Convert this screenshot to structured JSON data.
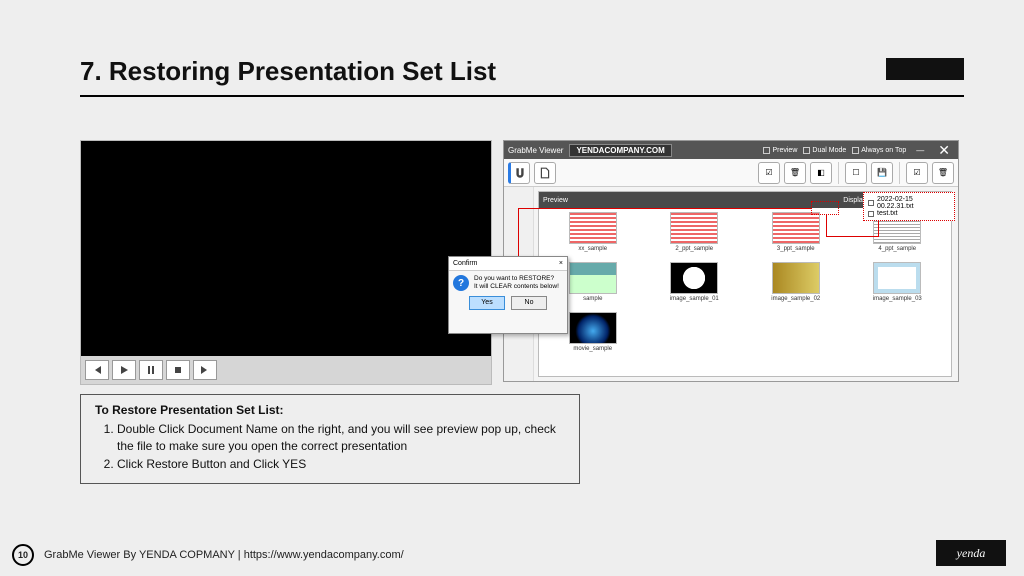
{
  "title": "7. Restoring Presentation Set List",
  "page_number": "10",
  "footer_text": "GrabMe Viewer By YENDA COPMANY | https://www.yendacompany.com/",
  "brand": "yenda",
  "instructions": {
    "heading": "To Restore Presentation Set List:",
    "steps": [
      "Double Click Document Name on the right, and you will see preview pop up, check the file to make sure you open the correct presentation",
      "Click Restore Button and Click YES"
    ]
  },
  "gm": {
    "title": "GrabMe Viewer",
    "brand": "YENDACOMPANY.COM",
    "opt_preview": "Preview",
    "opt_dual": "Dual Mode",
    "opt_top": "Always on Top",
    "preview_label": "Preview",
    "display_selected": "Display Selected Item"
  },
  "thumbs": {
    "t0": "xx_sample",
    "t1": "2_ppt_sample",
    "t2": "3_ppt_sample",
    "t3": "4_ppt_sample",
    "t4": "sample",
    "t5": "image_sample_01",
    "t6": "image_sample_02",
    "t7": "image_sample_03",
    "t8": "movie_sample"
  },
  "files": {
    "f0": "2022-02-15 00.22.31.txt",
    "f1": "test.txt"
  },
  "confirm": {
    "title": "Confirm",
    "line1": "Do you want to RESTORE?",
    "line2": "It will CLEAR contents below!",
    "yes": "Yes",
    "no": "No"
  }
}
